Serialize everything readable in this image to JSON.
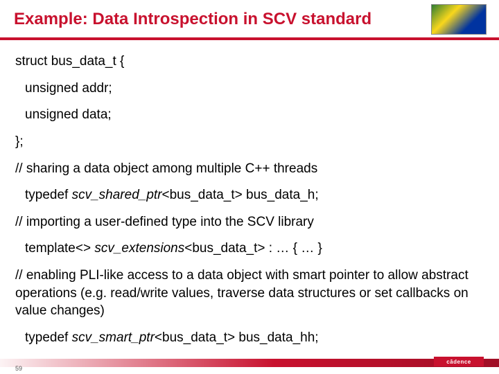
{
  "header": {
    "title": "Example: Data Introspection in SCV standard"
  },
  "code": {
    "line1": "struct bus_data_t {",
    "line2": "unsigned addr;",
    "line3": "unsigned data;",
    "line4": "};",
    "comment1": "// sharing a data object among multiple C++ threads",
    "line5a": "typedef ",
    "line5b": "scv_shared_ptr",
    "line5c": "<bus_data_t> bus_data_h;",
    "comment2": "// importing a user-defined type into the SCV library",
    "line6a": "template<> ",
    "line6b": "scv_extensions",
    "line6c": "<bus_data_t> : … { … }",
    "comment3": "// enabling PLI-like access to a data object with smart pointer to allow abstract operations (e.g. read/write values, traverse data structures or set callbacks on value changes)",
    "line7a": "typedef ",
    "line7b": "scv_smart_ptr",
    "line7c": "<bus_data_t> bus_data_hh;"
  },
  "footer": {
    "page": "59",
    "logo_text": "cādence"
  }
}
